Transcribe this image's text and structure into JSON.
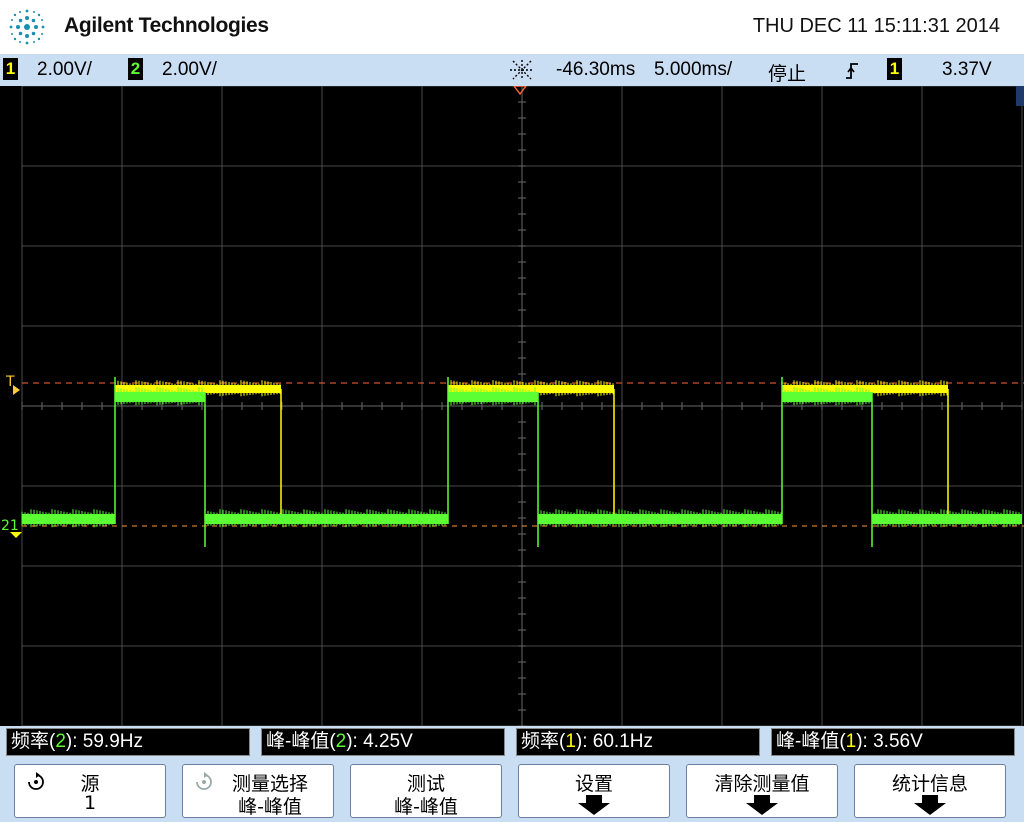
{
  "header": {
    "brand": "Agilent Technologies",
    "datetime": "THU DEC 11 15:11:31 2014"
  },
  "status": {
    "ch1_num": "1",
    "ch1_scale": "2.00V/",
    "ch2_num": "2",
    "ch2_scale": "2.00V/",
    "time_offset": "-46.30ms",
    "time_scale": "5.000ms/",
    "run_state": "停止",
    "trigger_source": "1",
    "trigger_level": "3.37V"
  },
  "colors": {
    "ch1": "#ffff00",
    "ch2": "#5cff33",
    "trigger_line": "#ff6633",
    "grid": "#555555"
  },
  "markers": {
    "trigger": "T",
    "channels": "21"
  },
  "measurements": [
    {
      "label": "频率(",
      "ch": "2",
      "label_end": "): 59.9Hz"
    },
    {
      "label": "峰-峰值(",
      "ch": "2",
      "label_end": "): 4.25V"
    },
    {
      "label": "频率(",
      "ch": "1",
      "label_end": "): 60.1Hz"
    },
    {
      "label": "峰-峰值(",
      "ch": "1",
      "label_end": "): 3.56V"
    }
  ],
  "softkeys": [
    {
      "line1": "源",
      "line2": "1",
      "icon": "rotate-knob-icon"
    },
    {
      "line1": "测量选择",
      "line2": "峰-峰值",
      "icon": "rotate-knob-icon-dim"
    },
    {
      "line1": "测试",
      "line2": "峰-峰值"
    },
    {
      "line1": "设置",
      "icon": "down-arrow-icon"
    },
    {
      "line1": "清除测量值",
      "icon": "down-arrow-icon"
    },
    {
      "line1": "统计信息",
      "icon": "down-arrow-icon"
    }
  ]
}
